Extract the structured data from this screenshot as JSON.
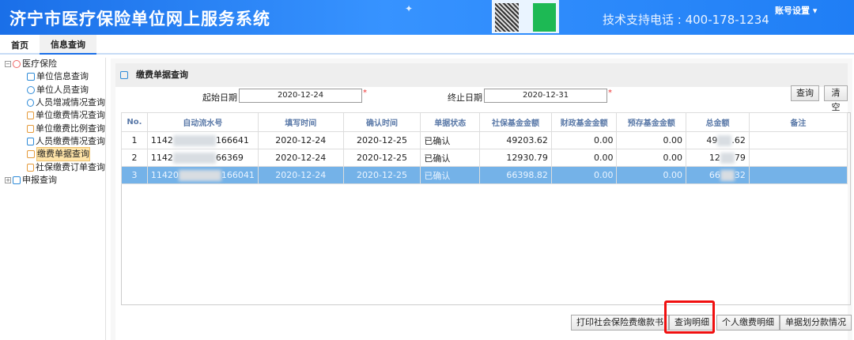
{
  "header": {
    "title": "济宁市医疗保险单位网上服务系统",
    "phone": "技术支持电话 : 400-178-1234",
    "account": "账号设置 ▾"
  },
  "tabs": [
    {
      "label": "首页"
    },
    {
      "label": "信息查询"
    }
  ],
  "tree": {
    "group1": "医疗保险",
    "items": [
      "单位信息查询",
      "单位人员查询",
      "人员增减情况查询",
      "单位缴费情况查询",
      "单位缴费比例查询",
      "人员缴费情况查询",
      "缴费单据查询",
      "社保缴费订单查询"
    ],
    "selected": "缴费单据查询",
    "group2": "申报查询"
  },
  "panel": {
    "title": "缴费单据查询",
    "start_label": "起始日期",
    "start_value": "2020-12-24",
    "end_label": "终止日期",
    "end_value": "2020-12-31",
    "required_mark": "*",
    "query": "查询",
    "clear": "清空"
  },
  "table": {
    "columns": [
      "No.",
      "自动流水号",
      "填写时间",
      "确认时间",
      "单据状态",
      "社保基金金额",
      "财政基金金额",
      "预存基金金额",
      "总金额",
      "备注"
    ],
    "rows": [
      {
        "no": "1",
        "serial_prefix": "1142",
        "serial_suffix": "166641",
        "fill": "2020-12-24",
        "confirm": "2020-12-25",
        "status": "已确认",
        "social": "49203.62",
        "finance": "0.00",
        "prestore": "0.00",
        "total_prefix": "49",
        "total_suffix": ".62",
        "note": ""
      },
      {
        "no": "2",
        "serial_prefix": "1142",
        "serial_suffix": "66369",
        "fill": "2020-12-24",
        "confirm": "2020-12-25",
        "status": "已确认",
        "social": "12930.79",
        "finance": "0.00",
        "prestore": "0.00",
        "total_prefix": "12",
        "total_suffix": "79",
        "note": ""
      },
      {
        "no": "3",
        "serial_prefix": "11420",
        "serial_suffix": "166041",
        "fill": "2020-12-24",
        "confirm": "2020-12-25",
        "status": "已确认",
        "social": "66398.82",
        "finance": "0.00",
        "prestore": "0.00",
        "total_prefix": "66",
        "total_suffix": "32",
        "note": ""
      }
    ]
  },
  "footer": {
    "print": "打印社会保险费缴款书",
    "detail": "查询明细",
    "personal": "个人缴费明细",
    "split": "单据划分款情况"
  }
}
